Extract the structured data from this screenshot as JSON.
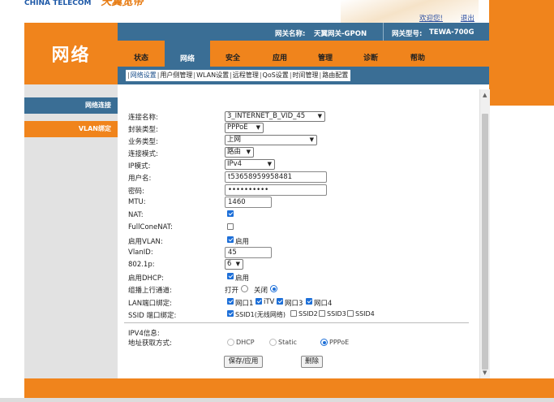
{
  "header": {
    "logo_text": "CHINA TELECOM",
    "brand_text": "天翼宽带",
    "welcome_link": "欢迎您!",
    "logout_link": "退出"
  },
  "infobar": {
    "gateway_name_label": "网关名称:",
    "gateway_name_value": "天翼网关-GPON",
    "gateway_model_label": "网关型号:",
    "gateway_model_value": "TEWA-700G"
  },
  "section_title": "网络",
  "tabs": [
    "状态",
    "网络",
    "安全",
    "应用",
    "管理",
    "诊断",
    "帮助"
  ],
  "active_tab": "网络",
  "subnav": [
    "网络设置",
    "用户侧管理",
    "WLAN设置",
    "远程管理",
    "QoS设置",
    "时间管理",
    "路由配置"
  ],
  "left_menu": [
    "网络连接",
    "VLAN绑定"
  ],
  "form": {
    "connection_name_label": "连接名称:",
    "connection_name_value": "3_INTERNET_B_VID_45",
    "encap_label": "封装类型:",
    "encap_value": "PPPoE",
    "service_label": "业务类型:",
    "service_value": "上网",
    "mode_label": "连接模式:",
    "mode_value": "路由",
    "ip_mode_label": "IP模式:",
    "ip_mode_value": "IPv4",
    "username_label": "用户名:",
    "username_value": "t53658959958481",
    "password_label": "密码:",
    "password_value": "••••••••••",
    "mtu_label": "MTU:",
    "mtu_value": "1460",
    "nat_label": "NAT:",
    "fullcone_label": "FullConeNAT:",
    "vlan_enable_label": "启用VLAN:",
    "enable_text": "启用",
    "vlanid_label": "VlanID:",
    "vlanid_value": "45",
    "p8021_label": "802.1p:",
    "p8021_value": "6",
    "dhcp_label": "启用DHCP:",
    "multicast_label": "组播上行通道:",
    "multicast_on": "打开",
    "multicast_off": "关闭",
    "lan_bind_label": "LAN端口绑定:",
    "lan_ports": [
      "网口1",
      "iTV",
      "网口3",
      "网口4"
    ],
    "ssid_bind_label": "SSID 端口绑定:",
    "ssids": [
      "SSID1(无线网络)",
      "SSID2",
      "SSID3",
      "SSID4"
    ],
    "ipv4_info_label": "IPV4信息:",
    "addr_method_label": "地址获取方式:",
    "addr_methods": [
      "DHCP",
      "Static",
      "PPPoE"
    ],
    "save_button": "保存/应用",
    "delete_button": "删除"
  }
}
